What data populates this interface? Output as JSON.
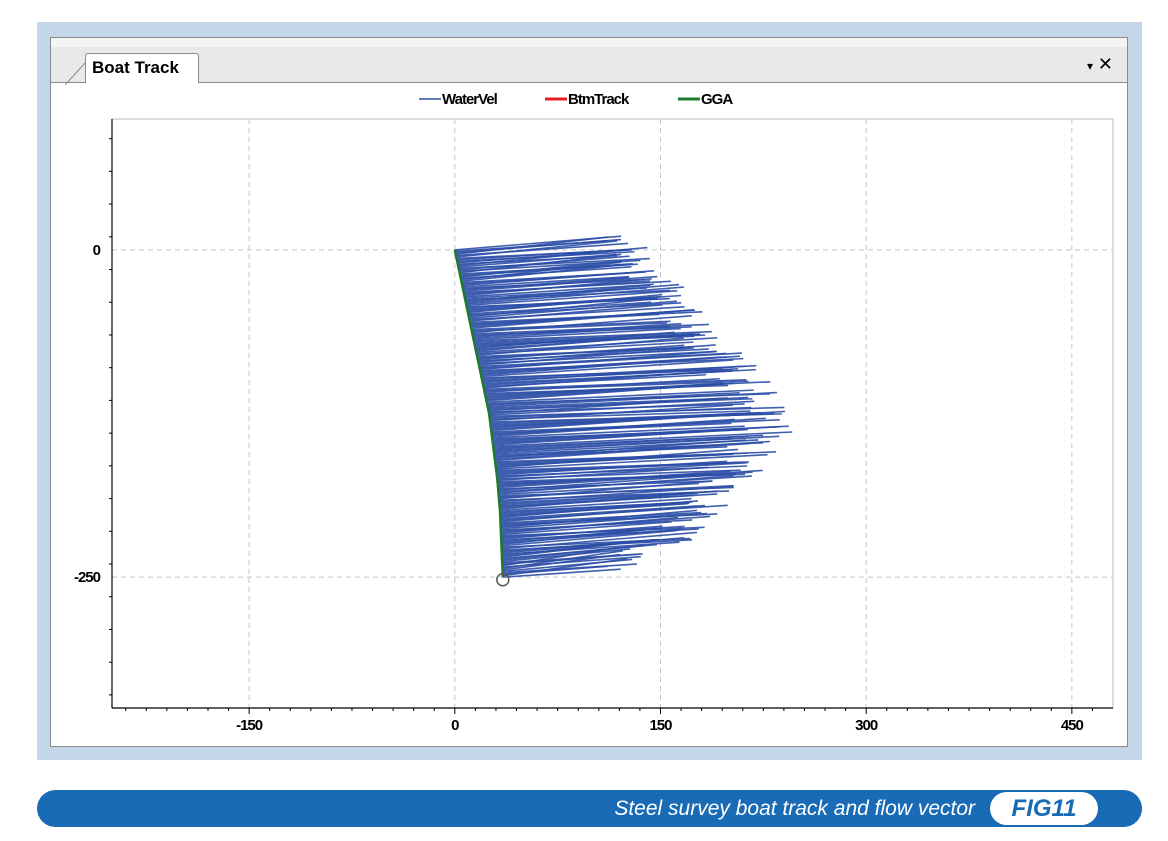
{
  "tab": {
    "title": "Boat Track",
    "menu_icon": "▾",
    "close_icon": "✕"
  },
  "legend": [
    {
      "name": "WaterVel",
      "color": "#2b4ea6"
    },
    {
      "name": "BtmTrack",
      "color": "#e81f1f"
    },
    {
      "name": "GGA",
      "color": "#1e7a2c"
    }
  ],
  "chart_data": {
    "type": "line",
    "xlim": [
      -250,
      480
    ],
    "ylim": [
      -350,
      100
    ],
    "x_ticks": [
      -150,
      0,
      150,
      300,
      450
    ],
    "y_ticks": [
      0,
      -250
    ],
    "x_tick_labels": [
      "-150",
      "0",
      "150",
      "300",
      "450"
    ],
    "y_tick_labels": [
      "0",
      "-250"
    ],
    "grid": true,
    "legend_position": "top-center",
    "series": [
      {
        "name": "GGA",
        "color": "#1e7a2c",
        "x": [
          0,
          5,
          10,
          15,
          20,
          25,
          28,
          31,
          33,
          34,
          35
        ],
        "y": [
          0,
          -25,
          -50,
          -75,
          -100,
          -125,
          -150,
          -175,
          -200,
          -225,
          -250
        ]
      },
      {
        "name": "WaterVel",
        "color": "#2b4ea6",
        "boat_y": [
          0,
          -25,
          -50,
          -75,
          -100,
          -125,
          -150,
          -175,
          -200,
          -225,
          -250
        ],
        "tip_x": [
          135,
          150,
          180,
          200,
          222,
          245,
          248,
          232,
          210,
          185,
          130
        ]
      }
    ],
    "end_marker": {
      "x": 35,
      "y": -252
    }
  },
  "caption": {
    "text": "Steel survey boat track and flow vector",
    "badge": "FIG11"
  }
}
